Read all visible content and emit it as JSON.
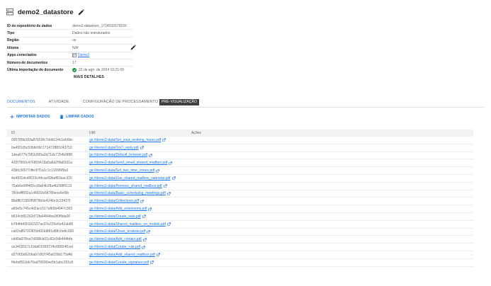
{
  "header": {
    "title": "demo2_datastore"
  },
  "properties": [
    {
      "label": "ID do repositório de dados",
      "value": "demo2-datastore_1724532679156"
    },
    {
      "label": "Tipo",
      "value": "Dados não estruturados"
    },
    {
      "label": "Região",
      "value": "us"
    },
    {
      "label": "Idioma",
      "value": "N/A"
    },
    {
      "label": "Apps conectados",
      "value": "Demo2"
    },
    {
      "label": "Número de documentos",
      "value": "17"
    },
    {
      "label": "Última importação de documento",
      "value": "22 de ago. de 2024 10:21:09"
    }
  ],
  "details_button": "MAIS DETALHES",
  "tabs": [
    {
      "label": "DOCUMENTOS",
      "active": true
    },
    {
      "label": "ATIVIDADE",
      "active": false
    },
    {
      "label": "CONFIGURAÇÃO DE PROCESSAMENTO",
      "active": false
    }
  ],
  "preview_badge": "PRÉ-VISUALIZAÇÃO",
  "toolbar": {
    "import_label": "IMPORTAR DADOS",
    "clear_label": "LIMPAR DADOS"
  },
  "table": {
    "columns": [
      "ID",
      "URI",
      "Ações"
    ],
    "rows": [
      {
        "id": "090785b183a87659fc7ddd134c1eb6bc",
        "uri": "gs://demo2-data/Set_your_working_hours.pdf"
      },
      {
        "id": "0a4f21d5c53bfe99c171472883243753",
        "uri": "gs://demo2-data/OoO_reply.pdf"
      },
      {
        "id": "1dea677b79f1b395a2d71dc7254b988f",
        "uri": "gs://demo2-data/Default_browser.pdf"
      },
      {
        "id": "420f7800c476809419a5a6d25fa8101a",
        "uri": "gs://demo2-data/Send_email_shared_mailbox.pdf"
      },
      {
        "id": "43bfc30077dfed7f1a1c1c1165f6f9a1",
        "uri": "gs://demo2-data/Set_two_time_zones.pdf"
      },
      {
        "id": "4e4911dcd9016c44cac69baf81bac315",
        "uri": "gs://demo2-data/Use_shared_mailbox_calendar.pdf"
      },
      {
        "id": "75ab6e00f465cc8a64b28a4b268f5113",
        "uri": "gs://demo2-data/Remove_shared_mailbox.pdf"
      },
      {
        "id": "78cbdff992a1d4932e0d785ece6cf9b",
        "uri": "gs://demo2-data/Basic_scheduling_meetings.pdf"
      },
      {
        "id": "8fa8fb71550f5879b0e4246e3c23437f",
        "uri": "gs://demo2-data/Collections.pdf"
      },
      {
        "id": "a65e5c745c4d2acc517afb5b4947c303",
        "uri": "gs://demo2-data/Add_extensions.pdf"
      },
      {
        "id": "b534cb81262d72fa6454fea3f0f9da00",
        "uri": "gs://demo2-data/Create_task.pdf"
      },
      {
        "id": "b744fd4901b1937ac07e220e6e42ab86",
        "uri": "gs://demo2-data/Shared_mailbox_on_mobile.pdf"
      },
      {
        "id": "ca02a85702905b693d881d88c0e8c065",
        "uri": "gs://demo2-data/Clean_browser.pdf"
      },
      {
        "id": "cdd0a078ca7d098cb01c82c0db444bfa",
        "uri": "gs://demo2-data/Add_contact.pdf"
      },
      {
        "id": "ce3402517c19dd01993724c68554f1ed",
        "uri": "gs://demo2-data/Create_rule.pdf"
      },
      {
        "id": "d27065d620bab7df1f745a028d175d4b",
        "uri": "gs://demo2-data/Add_shared_mailbox.pdf"
      },
      {
        "id": "f4ebd551bb76ad76590ee5b1abc281c8",
        "uri": "gs://demo2-data/Create_signature.pdf"
      }
    ]
  },
  "colors": {
    "accent": "#1a73e8",
    "success": "#1e8e3e",
    "badge_bg": "#3c4043"
  }
}
